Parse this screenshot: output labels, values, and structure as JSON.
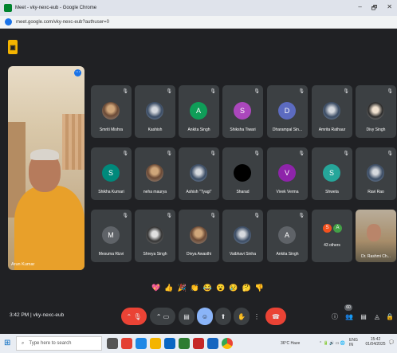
{
  "window": {
    "title": "Meet - vky-nexc-eub - Google Chrome",
    "minimize": "–",
    "maximize": "🗗"
  },
  "address": {
    "url": "meet.google.com/vky-nexc-eub?authuser=0"
  },
  "self_view": {
    "name": "Arun Kumar"
  },
  "participants": [
    {
      "name": "Smriti Mishra",
      "initial": "",
      "color": "#ffffff",
      "kind": "photo"
    },
    {
      "name": "Kashish",
      "initial": "",
      "color": "#ffffff",
      "kind": "photo"
    },
    {
      "name": "Ankita Singh",
      "initial": "A",
      "color": "#0f9d58",
      "kind": "initial"
    },
    {
      "name": "Shiksha Tiwari",
      "initial": "S",
      "color": "#ab47bc",
      "kind": "initial"
    },
    {
      "name": "Dharampal Sin...",
      "initial": "D",
      "color": "#5c6bc0",
      "kind": "initial"
    },
    {
      "name": "Amrita Rathaur",
      "initial": "",
      "color": "#ffffff",
      "kind": "photo"
    },
    {
      "name": "Divy Singh",
      "initial": "",
      "color": "#ffffff",
      "kind": "photo"
    },
    {
      "name": "Shikha Kumari",
      "initial": "S",
      "color": "#00897b",
      "kind": "initial"
    },
    {
      "name": "neha maurya",
      "initial": "",
      "color": "#ffffff",
      "kind": "photo"
    },
    {
      "name": "Ashish \"Tyagi\"",
      "initial": "",
      "color": "#ffffff",
      "kind": "photo"
    },
    {
      "name": "Sharad",
      "initial": "",
      "color": "#000000",
      "kind": "photo"
    },
    {
      "name": "Vivek Verma",
      "initial": "V",
      "color": "#8e24aa",
      "kind": "initial"
    },
    {
      "name": "Shweta",
      "initial": "S",
      "color": "#26a69a",
      "kind": "initial"
    },
    {
      "name": "Ravi Rao",
      "initial": "",
      "color": "#ffffff",
      "kind": "photo"
    },
    {
      "name": "Mesuma Rizvi",
      "initial": "M",
      "color": "#5f6368",
      "kind": "initial"
    },
    {
      "name": "Shreya Singh",
      "initial": "",
      "color": "#ffffff",
      "kind": "photo"
    },
    {
      "name": "Divya Awasthi",
      "initial": "",
      "color": "#ffffff",
      "kind": "photo"
    },
    {
      "name": "Vaibhavi Sinha",
      "initial": "",
      "color": "#ffffff",
      "kind": "photo"
    },
    {
      "name": "Ankita Singh",
      "initial": "A",
      "color": "#5f6368",
      "kind": "initial"
    }
  ],
  "others": {
    "label": "43 others",
    "a1": "S",
    "a2": "A"
  },
  "featured": {
    "name": "Dr. Rashmi Ch..."
  },
  "reactions": [
    "💖",
    "👍",
    "🎉",
    "👏",
    "😂",
    "😮",
    "😢",
    "🤔",
    "👎"
  ],
  "meeting": {
    "time": "3:42 PM",
    "separator": "|",
    "code": "vky-nexc-eub",
    "participant_count": "60"
  },
  "taskbar": {
    "search_placeholder": "Type here to search",
    "weather": "36°C Haze",
    "lang": "ENG IN",
    "clock_time": "15:42",
    "clock_date": "01/04/2025"
  }
}
